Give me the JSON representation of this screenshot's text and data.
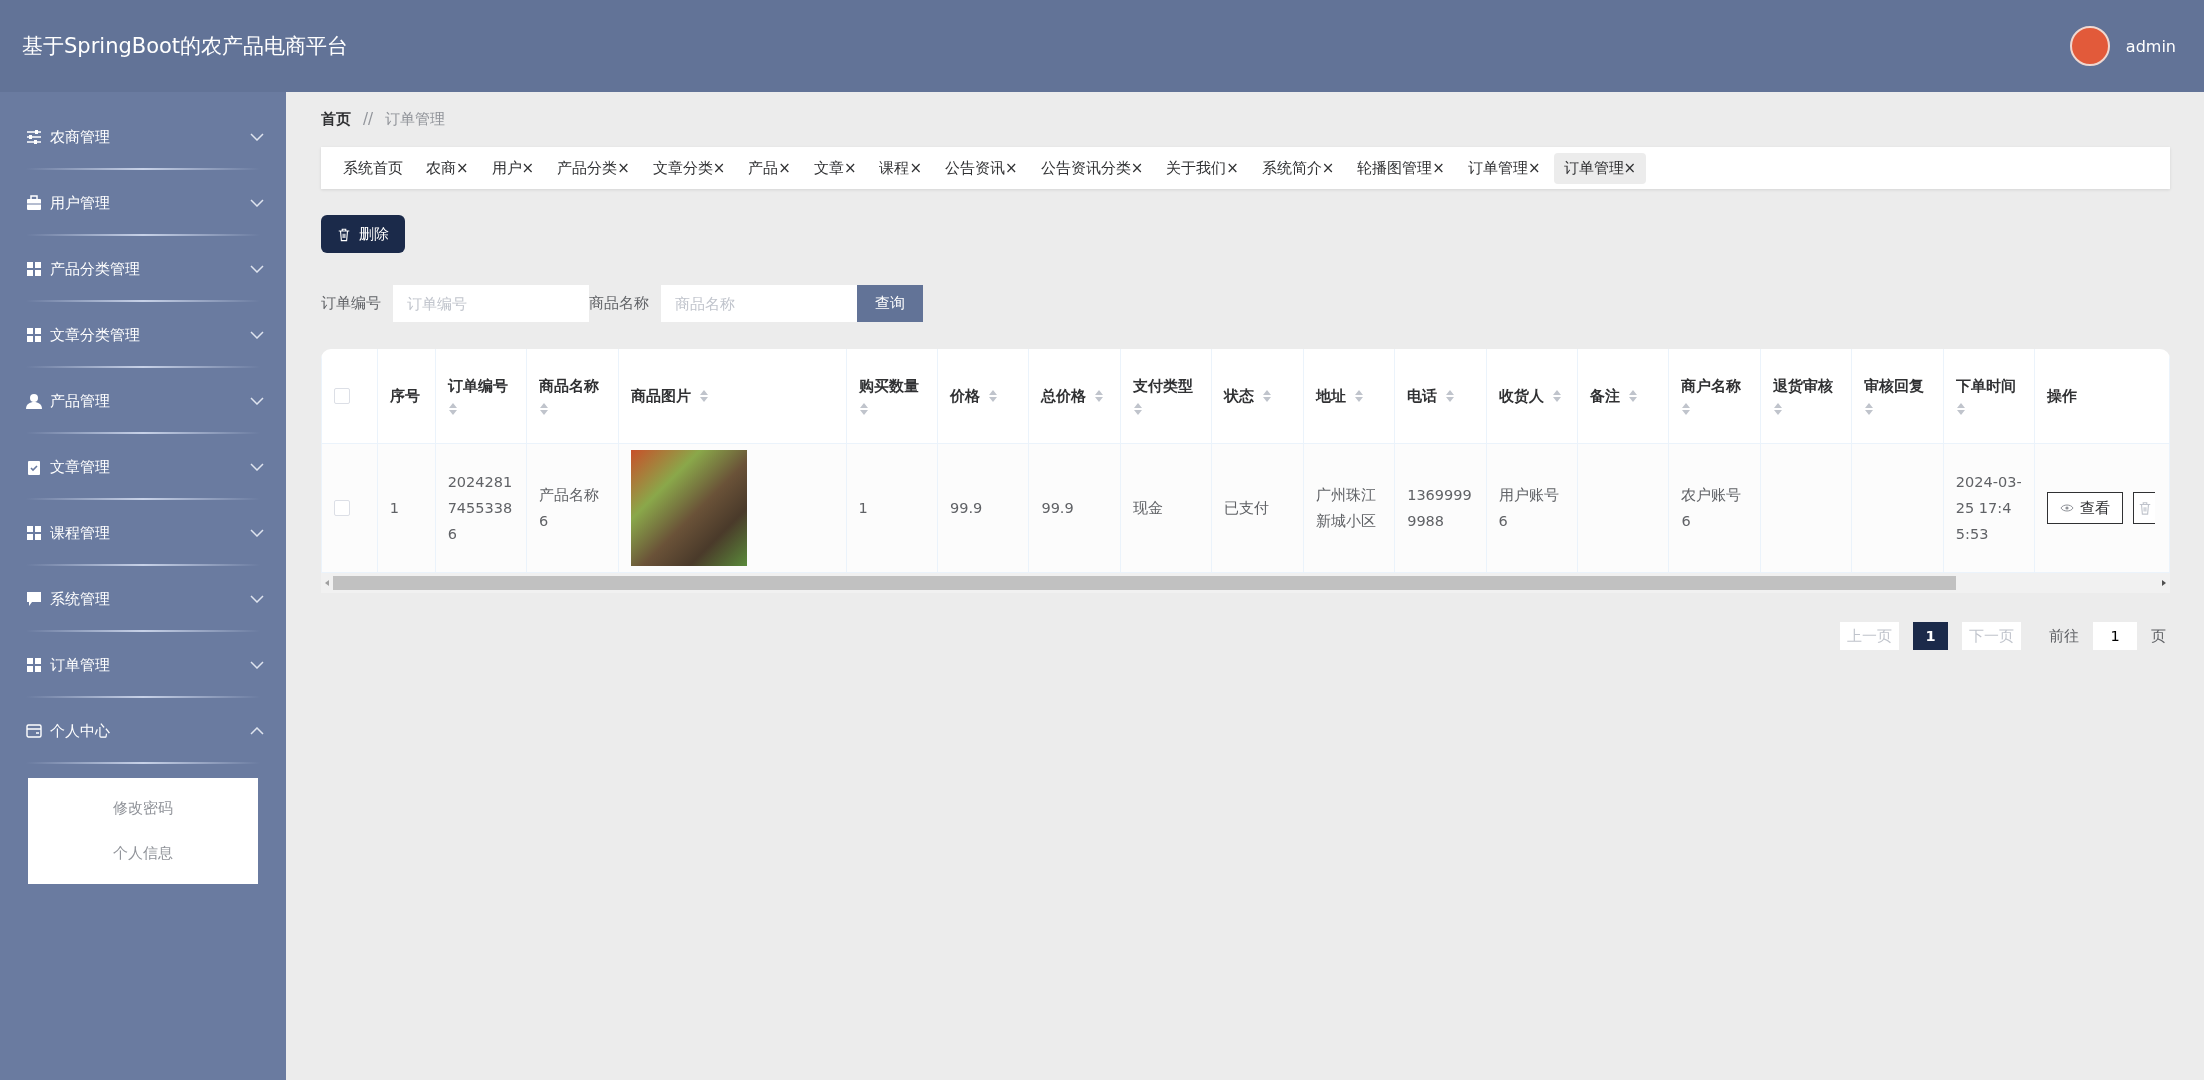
{
  "header": {
    "title": "基于SpringBoot的农产品电商平台",
    "user": "admin"
  },
  "sidebar": {
    "items": [
      {
        "label": "农商管理",
        "expanded": false
      },
      {
        "label": "用户管理",
        "expanded": false
      },
      {
        "label": "产品分类管理",
        "expanded": false
      },
      {
        "label": "文章分类管理",
        "expanded": false
      },
      {
        "label": "产品管理",
        "expanded": false
      },
      {
        "label": "文章管理",
        "expanded": false
      },
      {
        "label": "课程管理",
        "expanded": false
      },
      {
        "label": "系统管理",
        "expanded": false
      },
      {
        "label": "订单管理",
        "expanded": false
      },
      {
        "label": "个人中心",
        "expanded": true,
        "children": [
          {
            "label": "修改密码"
          },
          {
            "label": "个人信息"
          }
        ]
      }
    ]
  },
  "breadcrumb": [
    {
      "label": "首页"
    },
    {
      "label": "//"
    },
    {
      "label": "订单管理"
    }
  ],
  "tabs": [
    {
      "label": "系统首页",
      "selected": false
    },
    {
      "label": "农商",
      "close": "×",
      "selected": false
    },
    {
      "label": "用户",
      "close": "×",
      "selected": false
    },
    {
      "label": "产品分类",
      "close": "×",
      "selected": false
    },
    {
      "label": "文章分类",
      "close": "×",
      "selected": false
    },
    {
      "label": "产品",
      "close": "×",
      "selected": false
    },
    {
      "label": "文章",
      "close": "×",
      "selected": false
    },
    {
      "label": "课程",
      "close": "×",
      "selected": false
    },
    {
      "label": "公告资讯",
      "close": "×",
      "selected": false
    },
    {
      "label": "公告资讯分类",
      "close": "×",
      "selected": false
    },
    {
      "label": "关于我们",
      "close": "×",
      "selected": false
    },
    {
      "label": "系统简介",
      "close": "×",
      "selected": false
    },
    {
      "label": "轮播图管理",
      "close": "×",
      "selected": false
    },
    {
      "label": "订单管理",
      "close": "×",
      "selected": false
    },
    {
      "label": "订单管理",
      "close": "×",
      "selected": true
    }
  ],
  "toolbar": {
    "delete_button": "删除"
  },
  "search": {
    "fields": [
      {
        "label": "订单编号",
        "placeholder": "订单编号"
      },
      {
        "label": "商品名称",
        "placeholder": "商品名称"
      }
    ],
    "button": "查询"
  },
  "table": {
    "header_checkbox": {
      "checked": false
    },
    "columns": [
      {
        "label": "序号",
        "sortable": false
      },
      {
        "label": "订单编号",
        "sortable": true
      },
      {
        "label": "商品名称",
        "sortable": true
      },
      {
        "label": "商品图片",
        "sortable": true
      },
      {
        "label": "购买数量",
        "sortable": true
      },
      {
        "label": "价格",
        "sortable": true
      },
      {
        "label": "总价格",
        "sortable": true
      },
      {
        "label": "支付类型",
        "sortable": true
      },
      {
        "label": "状态",
        "sortable": true
      },
      {
        "label": "地址",
        "sortable": true
      },
      {
        "label": "电话",
        "sortable": true
      },
      {
        "label": "收货人",
        "sortable": true
      },
      {
        "label": "备注",
        "sortable": true
      },
      {
        "label": "商户名称",
        "sortable": true
      },
      {
        "label": "退货审核",
        "sortable": true
      },
      {
        "label": "审核回复",
        "sortable": true
      },
      {
        "label": "下单时间",
        "sortable": true
      },
      {
        "label": "操作",
        "sortable": false
      }
    ],
    "rows": [
      {
        "checked": false,
        "cells": [
          {
            "kind": "text",
            "text": "1"
          },
          {
            "kind": "text",
            "text": "20242817455338 6"
          },
          {
            "kind": "text",
            "text": "产品名称6"
          },
          {
            "kind": "image"
          },
          {
            "kind": "text",
            "text": "1"
          },
          {
            "kind": "text",
            "text": "99.9"
          },
          {
            "kind": "text",
            "text": "99.9"
          },
          {
            "kind": "text",
            "text": "现金"
          },
          {
            "kind": "text",
            "text": "已支付"
          },
          {
            "kind": "text",
            "text": "广州珠江新城小区"
          },
          {
            "kind": "text",
            "text": "13699999988"
          },
          {
            "kind": "text",
            "text": "用户账号6"
          },
          {
            "kind": "empty"
          },
          {
            "kind": "text",
            "text": "农户账号6"
          },
          {
            "kind": "empty"
          },
          {
            "kind": "empty"
          },
          {
            "kind": "text",
            "text": "2024-03-25 17:45:53"
          },
          {
            "kind": "actions",
            "view": "查看"
          }
        ]
      }
    ]
  },
  "pagination": {
    "prev": "上一页",
    "pages": [
      {
        "label": "1",
        "selected": true
      }
    ],
    "next": "下一页",
    "goto": "前往",
    "page_value": "1",
    "page_unit": "页"
  }
}
